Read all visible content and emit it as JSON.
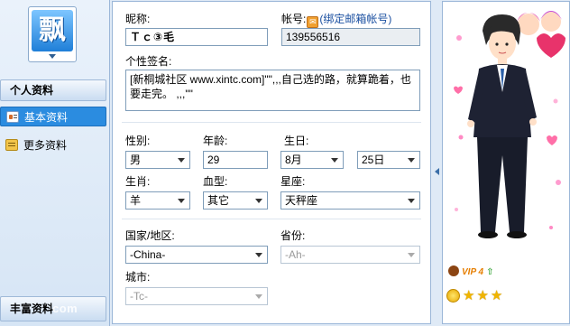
{
  "sidebar": {
    "avatar_char": "飘",
    "section_personal": "个人资料",
    "items": [
      {
        "label": "基本资料",
        "icon": "profile-card-icon",
        "active": true
      },
      {
        "label": "更多资料",
        "icon": "more-info-icon",
        "active": false
      }
    ],
    "section_rich": "丰富资料",
    "watermark": "com"
  },
  "form": {
    "nickname_label": "昵称:",
    "nickname_value": "Ｔｃ③毛",
    "account_label": "帐号:",
    "account_bind_link": "(绑定邮箱帐号)",
    "account_value": "139556516",
    "signature_label": "个性签名:",
    "signature_value": "[新桐城社区 www.xintc.com]\"\",,,自己选的路，就算跪着，也要走完。 ,,,\"\"",
    "gender_label": "性别:",
    "gender_value": "男",
    "age_label": "年龄:",
    "age_value": "29",
    "birthday_label": "生日:",
    "birth_month": "8月",
    "birth_day": "25日",
    "zodiac_label": "生肖:",
    "zodiac_value": "羊",
    "blood_label": "血型:",
    "blood_value": "其它",
    "constellation_label": "星座:",
    "constellation_value": "天秤座",
    "country_label": "国家/地区:",
    "country_value": "-China-",
    "province_label": "省份:",
    "province_value": "-Ah-",
    "city_label": "城市:",
    "city_value": "-Tc-"
  },
  "show_panel": {
    "vip_label": "VIP 4",
    "stars": 3,
    "colors": {
      "accent": "#2b8ce0",
      "suit": "#1e2233",
      "heart": "#e8336b"
    }
  }
}
